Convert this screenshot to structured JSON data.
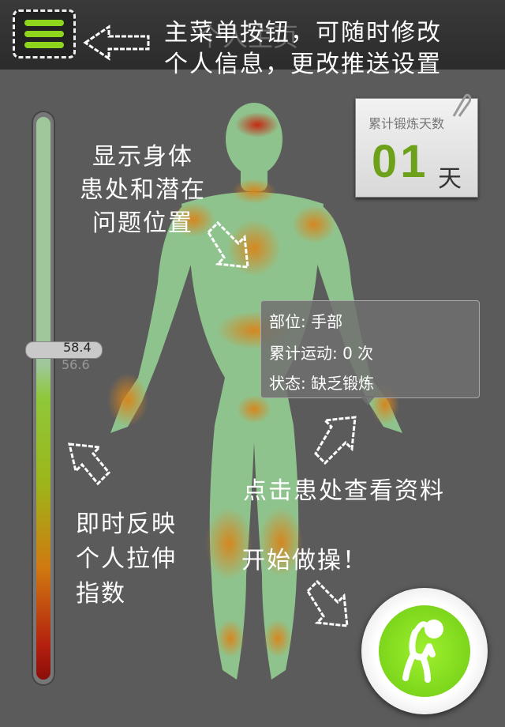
{
  "header": {
    "title_faint": "个人主页",
    "menu_tip_line1": "主菜单按钮，可随时修改",
    "menu_tip_line2": "个人信息，更改推送设置"
  },
  "annotations": {
    "body_tip": [
      "显示身体",
      "患处和潜在",
      "问题位置"
    ],
    "click_tip": "点击患处查看资料",
    "index_tip": [
      "即时反映",
      "个人拉伸",
      "指数"
    ],
    "start_tip": "开始做操！"
  },
  "counter": {
    "label": "累计锻炼天数",
    "value": "01",
    "unit": "天"
  },
  "slider": {
    "current": "58.4",
    "previous": "56.6"
  },
  "popup": {
    "part": "部位: 手部",
    "count": "累计运动: 0 次",
    "status": "状态: 缺乏锻炼"
  },
  "colors": {
    "accent": "#8ed61c",
    "counter_green": "#6ea11a",
    "body": "#8fc38d",
    "hotspot_orange": "#d9841a",
    "hotspot_red": "#c42a12"
  },
  "icons": {
    "menu": "menu-icon",
    "start": "exercise-figure-icon"
  }
}
